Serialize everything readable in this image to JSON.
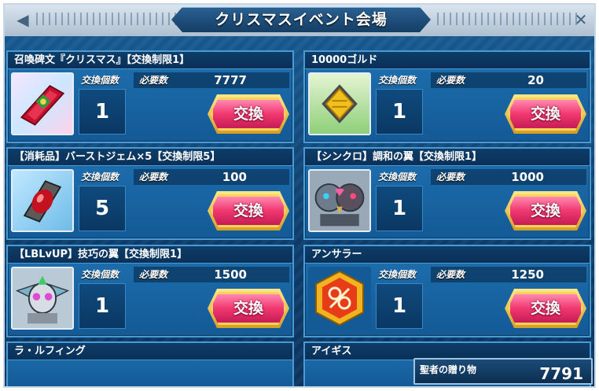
{
  "header": {
    "title": "クリスマスイベント会場"
  },
  "labels": {
    "qty": "交換個数",
    "need": "必要数",
    "exchange": "交換"
  },
  "items": [
    {
      "title": "召喚碑文『クリスマス』【交換制限1】",
      "qty": "1",
      "need": "7777",
      "icon": "christmas-inscription-icon"
    },
    {
      "title": "10000ゴルド",
      "qty": "1",
      "need": "20",
      "icon": "gold-coin-icon"
    },
    {
      "title": "【消耗品】バーストジェム×5【交換制限5】",
      "qty": "5",
      "need": "100",
      "icon": "burst-gem-icon"
    },
    {
      "title": "【シンクロ】調和の翼【交換制限1】",
      "qty": "1",
      "need": "1000",
      "icon": "harmony-wing-icon"
    },
    {
      "title": "【LBLvUP】技巧の翼【交換制限1】",
      "qty": "1",
      "need": "1500",
      "icon": "skill-wing-icon"
    },
    {
      "title": "アンサラー",
      "qty": "1",
      "need": "1250",
      "icon": "answerer-emblem-icon"
    }
  ],
  "partial_items": [
    {
      "title": "ラ・ルフィング"
    },
    {
      "title": "アイギス"
    }
  ],
  "currency": {
    "label": "聖者の贈り物",
    "value": "7791"
  },
  "colors": {
    "accent": "#f0386f",
    "panel": "#1f70b0",
    "frame": "#4a9ad4"
  }
}
